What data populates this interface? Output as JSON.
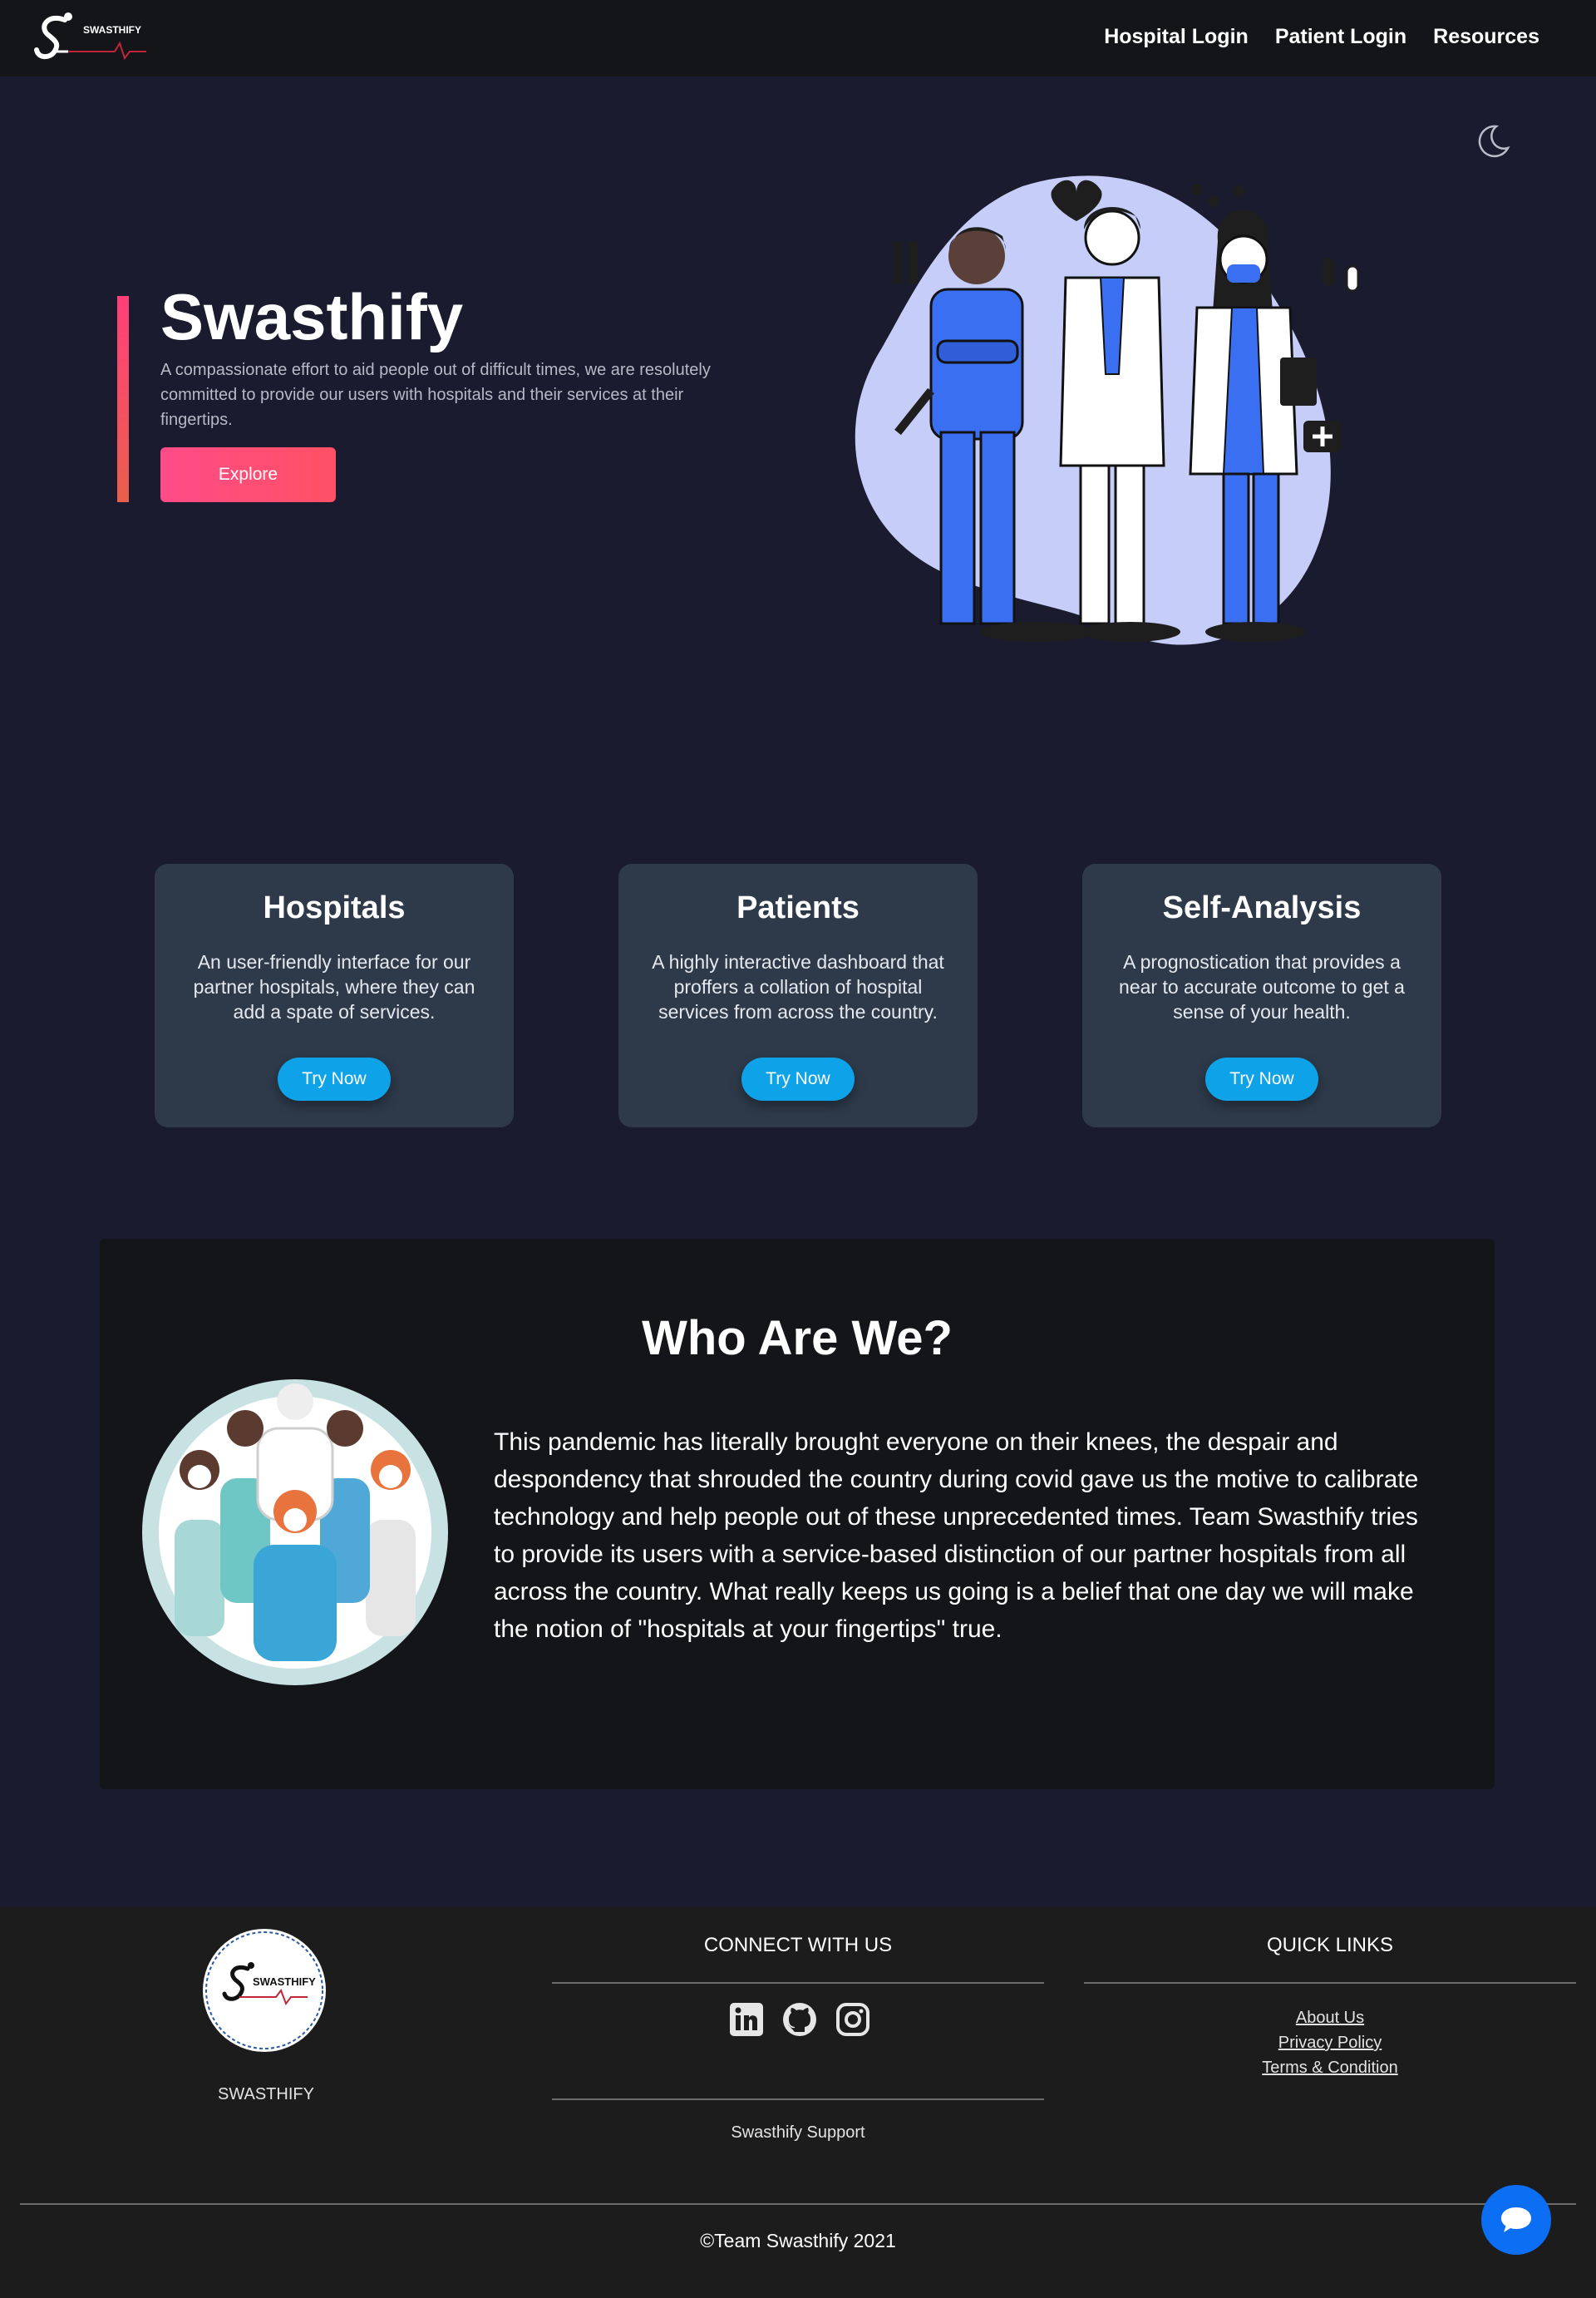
{
  "nav": {
    "brand": "SWASTHIFY",
    "links": [
      "Hospital Login",
      "Patient Login",
      "Resources"
    ]
  },
  "hero": {
    "title": "Swasthify",
    "description": "A compassionate effort to aid people out of difficult times, we are resolutely committed to provide our users with hospitals and their services at their fingertips.",
    "cta": "Explore"
  },
  "cards": [
    {
      "title": "Hospitals",
      "description": "An user-friendly interface for our partner hospitals, where they can add a spate of services.",
      "cta": "Try Now"
    },
    {
      "title": "Patients",
      "description": "A highly interactive dashboard that proffers a collation of hospital services from across the country.",
      "cta": "Try Now"
    },
    {
      "title": "Self-Analysis",
      "description": "A prognostication that provides a near to accurate outcome to get a sense of your health.",
      "cta": "Try Now"
    }
  ],
  "who": {
    "title": "Who Are We?",
    "text": "This pandemic has literally brought everyone on their knees, the despair and despondency that shrouded the country during covid gave us the motive to calibrate technology and help people out of these unprecedented times. Team Swasthify tries to provide its users with a service-based distinction of our partner hospitals from all across the country. What really keeps us going is a belief that one day we will make the notion of \"hospitals at your fingertips\" true."
  },
  "footer": {
    "brand": "SWASTHIFY",
    "connect_heading": "CONNECT WITH US",
    "quick_heading": "QUICK LINKS",
    "social_icons": [
      "linkedin-icon",
      "github-icon",
      "instagram-icon"
    ],
    "support": "Swasthify Support",
    "quick_links": [
      "About Us",
      "Privacy Policy",
      "Terms & Condition"
    ],
    "copyright": "©Team Swasthify 2021"
  },
  "colors": {
    "page_bg": "#1a1b2e",
    "nav_bg": "#141518",
    "card_bg": "#2e3a4a",
    "accent_pink": "#ff4b87",
    "button_blue": "#0ea2e8",
    "chat_blue": "#0b6ef3",
    "illustration_blue": "#3b6ff2"
  }
}
